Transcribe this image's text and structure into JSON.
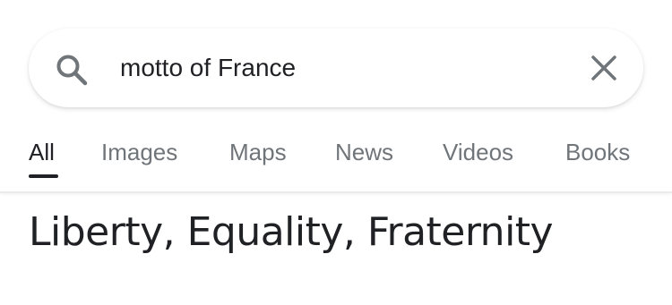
{
  "search": {
    "query": "motto of France",
    "search_icon": "search-icon",
    "clear_icon": "close-icon"
  },
  "tabs": [
    {
      "label": "All",
      "active": true
    },
    {
      "label": "Images",
      "active": false
    },
    {
      "label": "Maps",
      "active": false
    },
    {
      "label": "News",
      "active": false
    },
    {
      "label": "Videos",
      "active": false
    },
    {
      "label": "Books",
      "active": false
    }
  ],
  "answer": {
    "text": "Liberty, Equality, Fraternity"
  },
  "colors": {
    "text_primary": "#202124",
    "text_secondary": "#70757a",
    "icon_gray": "#70757a",
    "divider": "#ebebeb"
  }
}
